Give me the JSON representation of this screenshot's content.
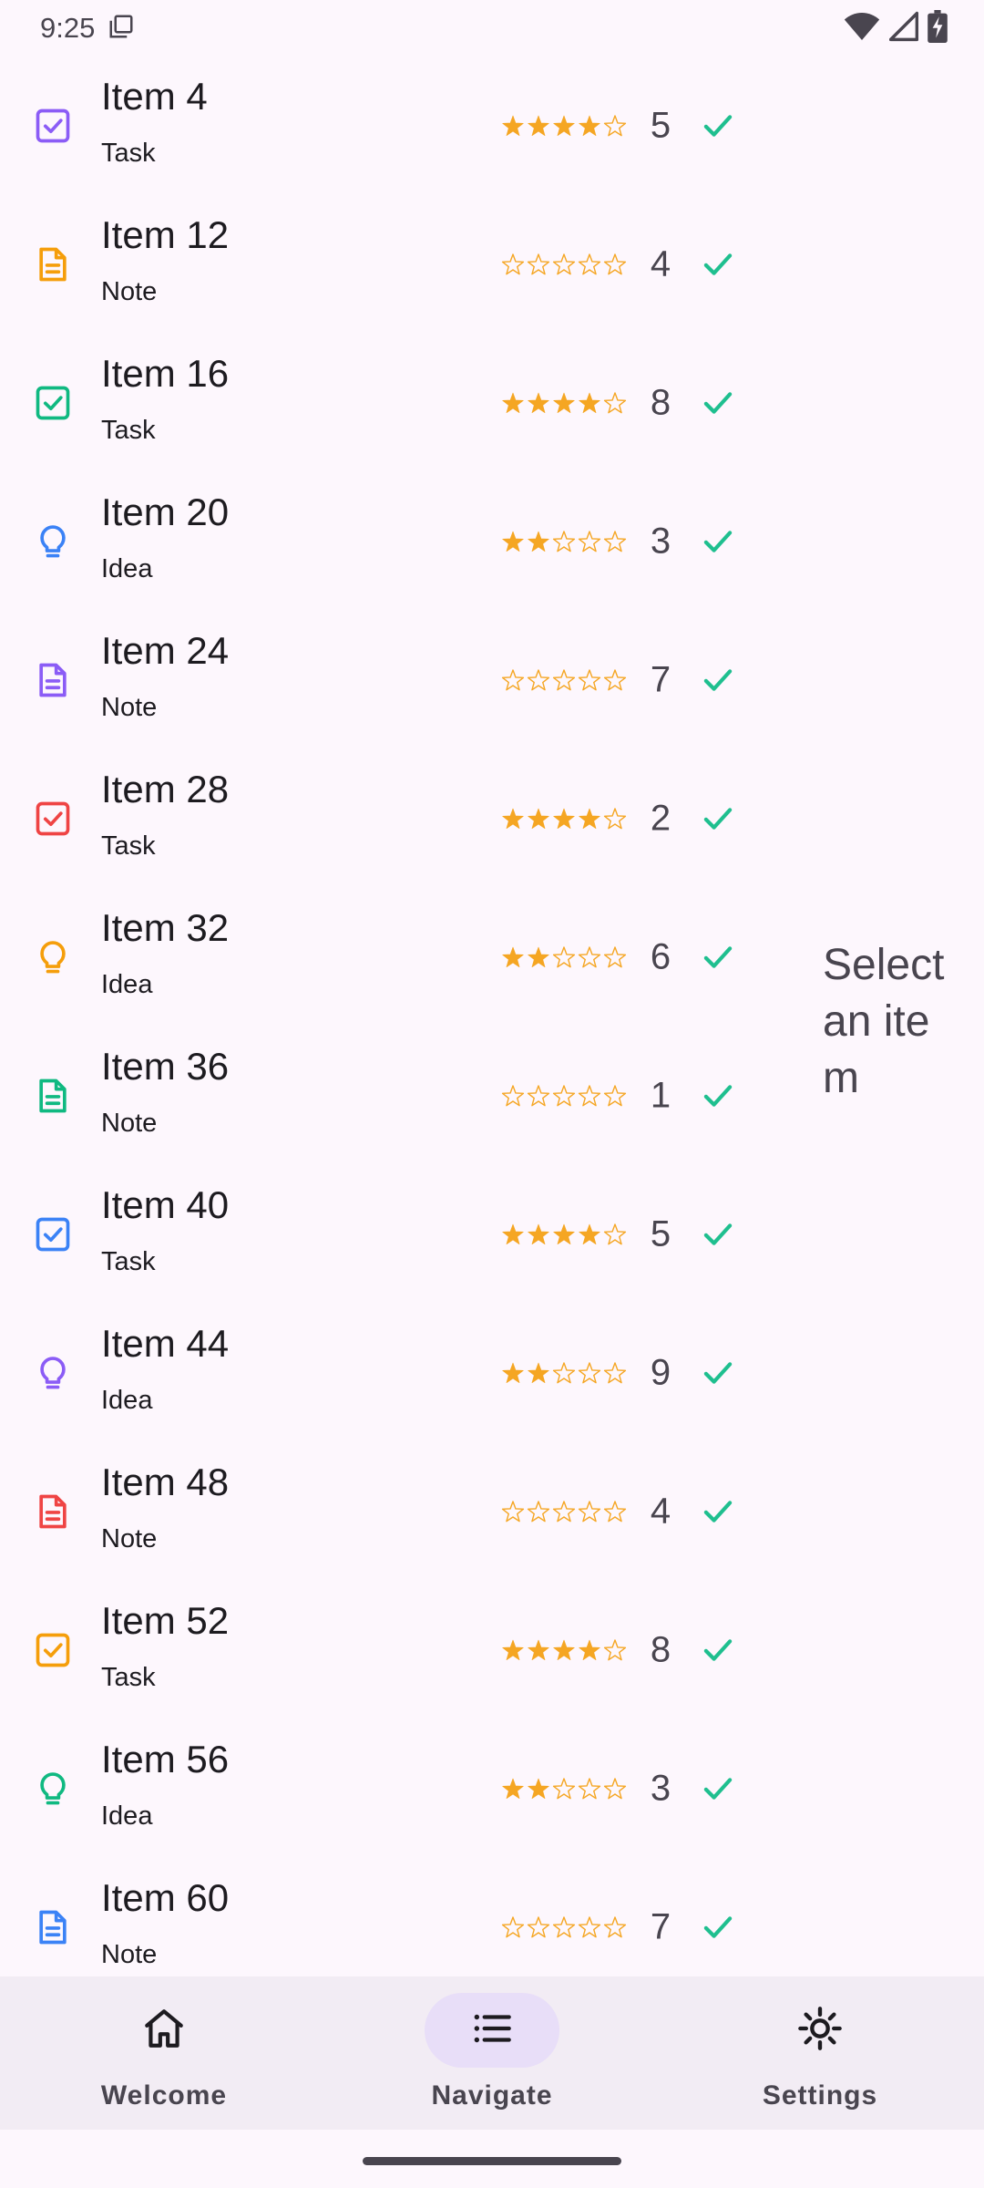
{
  "status_bar": {
    "time": "9:25"
  },
  "colors": {
    "star": "#F5A623",
    "check": "#1FBF8F",
    "purple": "#8B5CF6",
    "orange": "#F59E0B",
    "green": "#10B981",
    "blue": "#3B82F6",
    "red": "#EF4444"
  },
  "items": [
    {
      "title": "Item 4",
      "type": "Task",
      "icon": "checkbox-icon",
      "color": "#8B5CF6",
      "rating": 4,
      "count": "5"
    },
    {
      "title": "Item 12",
      "type": "Note",
      "icon": "note-icon",
      "color": "#F59E0B",
      "rating": 0,
      "count": "4"
    },
    {
      "title": "Item 16",
      "type": "Task",
      "icon": "checkbox-icon",
      "color": "#10B981",
      "rating": 4,
      "count": "8"
    },
    {
      "title": "Item 20",
      "type": "Idea",
      "icon": "lightbulb-icon",
      "color": "#3B82F6",
      "rating": 2,
      "count": "3"
    },
    {
      "title": "Item 24",
      "type": "Note",
      "icon": "note-icon",
      "color": "#8B5CF6",
      "rating": 0,
      "count": "7"
    },
    {
      "title": "Item 28",
      "type": "Task",
      "icon": "checkbox-icon",
      "color": "#EF4444",
      "rating": 4,
      "count": "2"
    },
    {
      "title": "Item 32",
      "type": "Idea",
      "icon": "lightbulb-icon",
      "color": "#F59E0B",
      "rating": 2,
      "count": "6"
    },
    {
      "title": "Item 36",
      "type": "Note",
      "icon": "note-icon",
      "color": "#10B981",
      "rating": 0,
      "count": "1"
    },
    {
      "title": "Item 40",
      "type": "Task",
      "icon": "checkbox-icon",
      "color": "#3B82F6",
      "rating": 4,
      "count": "5"
    },
    {
      "title": "Item 44",
      "type": "Idea",
      "icon": "lightbulb-icon",
      "color": "#8B5CF6",
      "rating": 2,
      "count": "9"
    },
    {
      "title": "Item 48",
      "type": "Note",
      "icon": "note-icon",
      "color": "#EF4444",
      "rating": 0,
      "count": "4"
    },
    {
      "title": "Item 52",
      "type": "Task",
      "icon": "checkbox-icon",
      "color": "#F59E0B",
      "rating": 4,
      "count": "8"
    },
    {
      "title": "Item 56",
      "type": "Idea",
      "icon": "lightbulb-icon",
      "color": "#10B981",
      "rating": 2,
      "count": "3"
    },
    {
      "title": "Item 60",
      "type": "Note",
      "icon": "note-icon",
      "color": "#3B82F6",
      "rating": 0,
      "count": "7"
    }
  ],
  "detail": {
    "placeholder": "Select an item"
  },
  "bottom_nav": [
    {
      "label": "Welcome",
      "icon": "home-icon",
      "active": false
    },
    {
      "label": "Navigate",
      "icon": "list-icon",
      "active": true
    },
    {
      "label": "Settings",
      "icon": "settings-icon",
      "active": false
    }
  ]
}
